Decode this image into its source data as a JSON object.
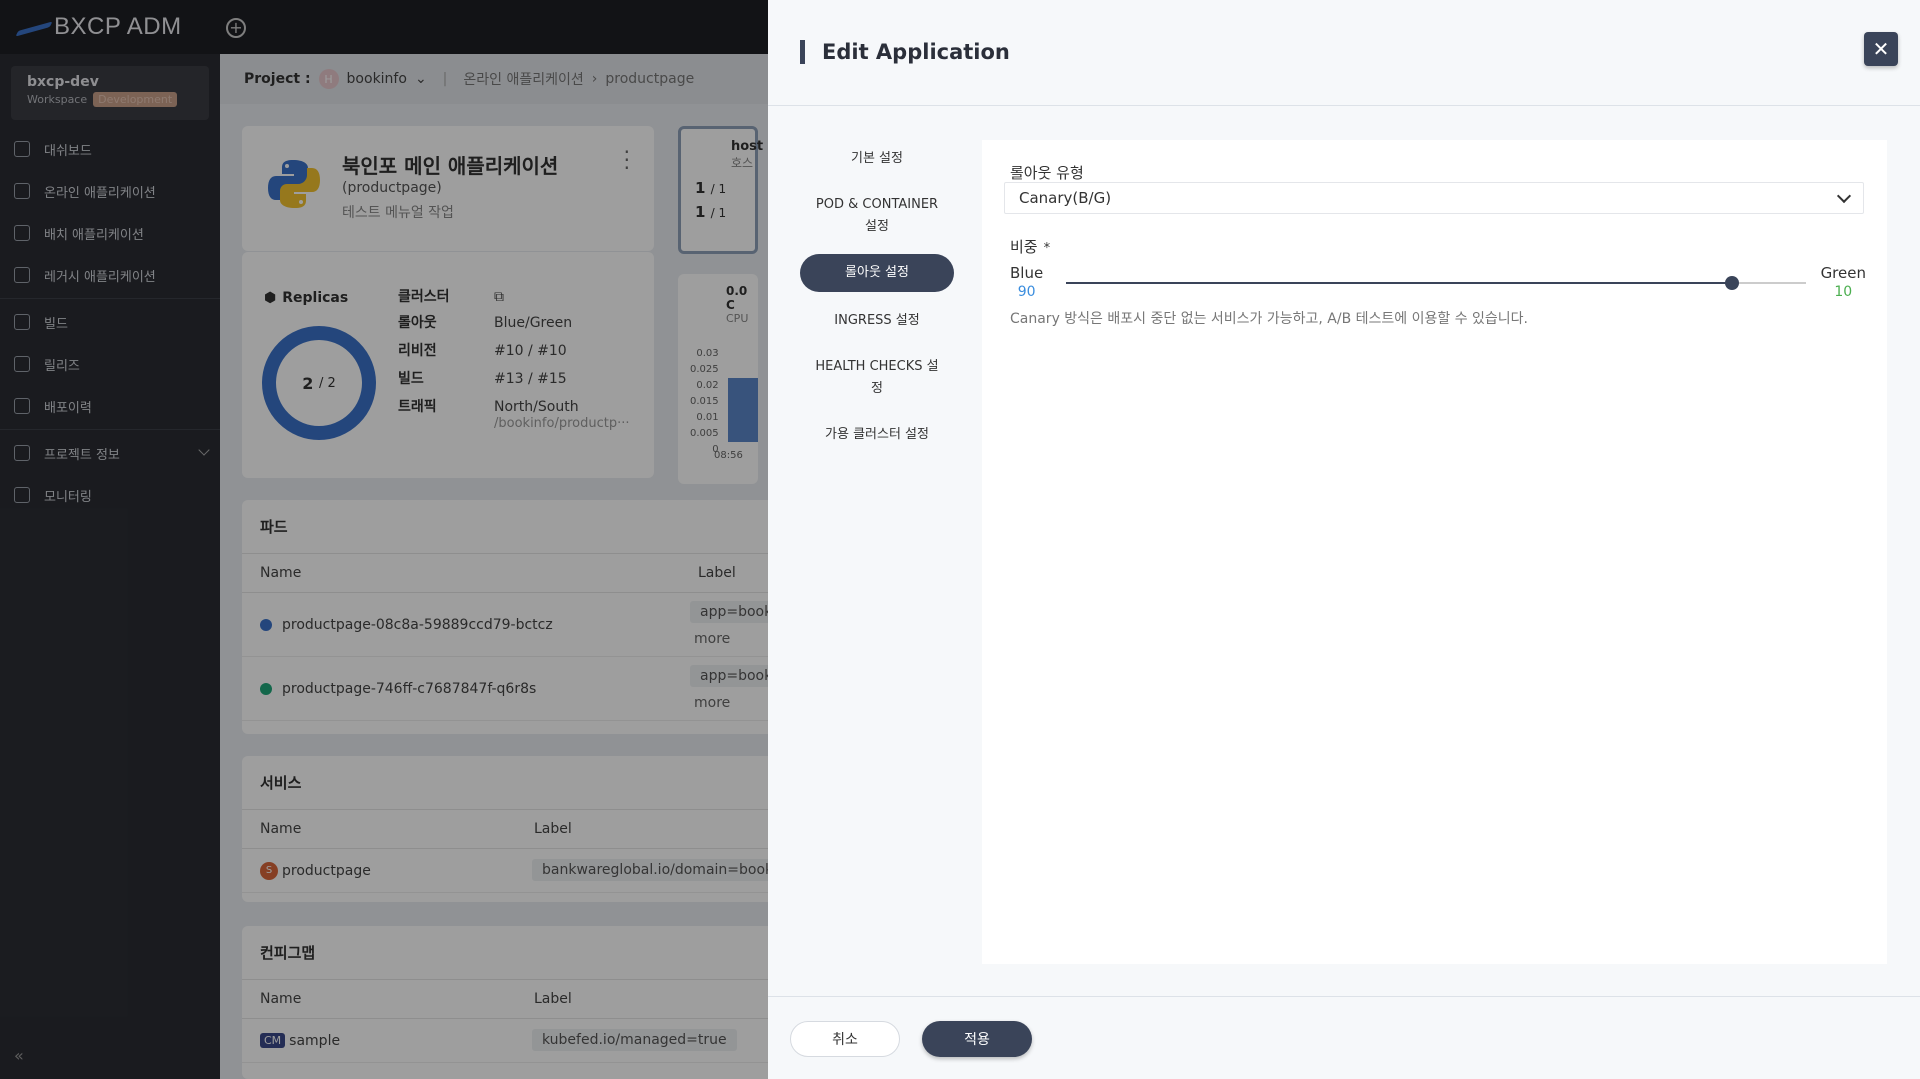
{
  "app": {
    "logo_text": "BXCP ADM"
  },
  "workspace": {
    "name": "bxcp-dev",
    "label": "Workspace",
    "badge": "Development"
  },
  "sidebar": {
    "items": [
      {
        "label": "대쉬보드",
        "icon": "dashboard-icon"
      },
      {
        "label": "온라인 애플리케이션",
        "icon": "online-app-icon"
      },
      {
        "label": "배치 애플리케이션",
        "icon": "batch-app-icon"
      },
      {
        "label": "레거시 애플리케이션",
        "icon": "legacy-app-icon"
      },
      {
        "label": "빌드",
        "icon": "build-icon"
      },
      {
        "label": "릴리즈",
        "icon": "release-icon"
      },
      {
        "label": "배포이력",
        "icon": "deploy-history-icon"
      },
      {
        "label": "프로젝트 정보",
        "icon": "project-info-icon"
      },
      {
        "label": "모니터링",
        "icon": "monitoring-icon"
      }
    ],
    "collapse_glyph": "«"
  },
  "breadcrumb": {
    "project_label": "Project :",
    "project_avatar": "H",
    "project_name": "bookinfo",
    "crumb1": "온라인 애플리케이션",
    "crumb2": "productpage"
  },
  "app_card": {
    "title": "북인포 메인 애플리케이션",
    "subtitle": "(productpage)",
    "description": "테스트 메뉴얼 작업"
  },
  "info": {
    "replicas_label": "Replicas",
    "replicas_value": "2",
    "replicas_total": "/ 2",
    "rows": [
      {
        "key": "클러스터",
        "value": ""
      },
      {
        "key": "롤아웃",
        "value": "Blue/Green"
      },
      {
        "key": "리비전",
        "value": "#10 / #10"
      },
      {
        "key": "빌드",
        "value": "#13 / #15"
      },
      {
        "key": "트래픽",
        "value": "North/South",
        "value2": "/bookinfo/productp···"
      }
    ]
  },
  "host_card": {
    "title": "host",
    "sub": "호스",
    "r1": "1",
    "r1_total": "/ 1",
    "r2": "1",
    "r2_total": "/ 1"
  },
  "cpu_card": {
    "value": "0.0 C",
    "label": "CPU",
    "ticks": [
      "0.03",
      "0.025",
      "0.02",
      "0.015",
      "0.01",
      "0.005",
      "0"
    ],
    "time": "08:56"
  },
  "pods": {
    "title": "파드",
    "col_name": "Name",
    "col_label": "Label",
    "rows": [
      {
        "name": "productpage-08c8a-59889ccd79-bctcz",
        "label": "app=book",
        "more": "more",
        "color": "#3a72c9"
      },
      {
        "name": "productpage-746ff-c7687847f-q6r8s",
        "label": "app=book",
        "more": "more",
        "color": "#1fa77a"
      }
    ]
  },
  "services": {
    "title": "서비스",
    "col_name": "Name",
    "col_label": "Label",
    "rows": [
      {
        "badge": "S",
        "name": "productpage",
        "label": "bankwareglobal.io/domain=booki"
      }
    ]
  },
  "configmaps": {
    "title": "컨피그맵",
    "col_name": "Name",
    "col_label": "Label",
    "rows": [
      {
        "badge": "CM",
        "name": "sample",
        "label": "kubefed.io/managed=true"
      }
    ]
  },
  "drawer": {
    "title": "Edit Application",
    "close_glyph": "✕",
    "menu": [
      {
        "label": "기본 설정",
        "active": false
      },
      {
        "label": "POD & CONTAINER 설정",
        "active": false
      },
      {
        "label": "롤아웃 설정",
        "active": true
      },
      {
        "label": "INGRESS 설정",
        "active": false
      },
      {
        "label": "HEALTH CHECKS 설정",
        "active": false
      },
      {
        "label": "가용 클러스터 설정",
        "active": false
      }
    ],
    "rollout_type_label": "롤아웃 유형",
    "rollout_type_value": "Canary(B/G)",
    "weight_label": "비중",
    "weight_required": "*",
    "blue_label": "Blue",
    "blue_value": "90",
    "green_label": "Green",
    "green_value": "10",
    "weight_fraction": 0.9,
    "help_text": "Canary 방식은 배포시 중단 없는 서비스가 가능하고, A/B 테스트에 이용할 수 있습니다.",
    "cancel_label": "취소",
    "apply_label": "적용"
  }
}
